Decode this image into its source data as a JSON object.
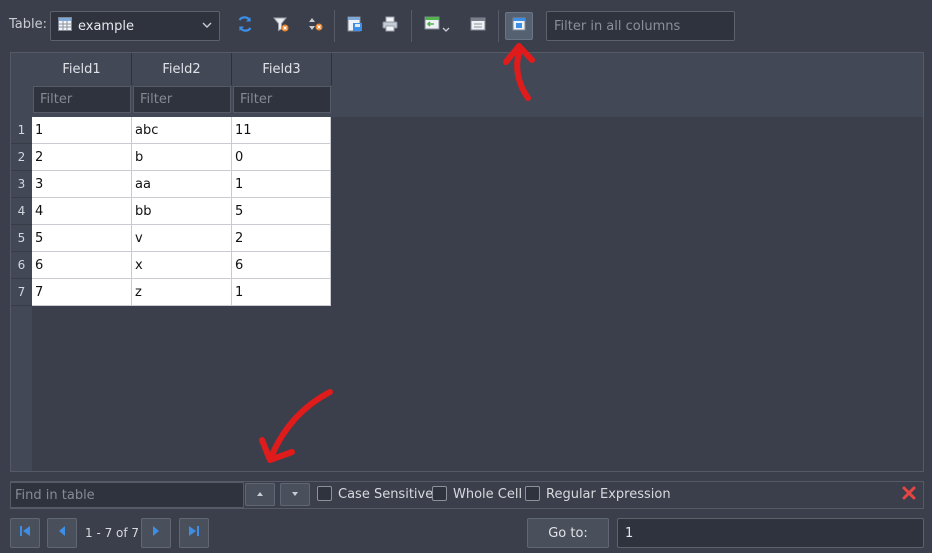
{
  "toolbar": {
    "table_label": "Table:",
    "table_value": "example",
    "filter_all_placeholder": "Filter in all columns"
  },
  "icons": {
    "table_icon": "table-icon",
    "refresh": "refresh-icon",
    "clear_filters": "clear-filter-icon",
    "clear_sort": "clear-sort-icon",
    "save_changes": "save-filter-view-icon",
    "print": "print-icon",
    "insert_record": "insert-record-icon",
    "delete_record": "delete-record-icon",
    "toggle_format": "toggle-format-toolbar-icon"
  },
  "grid": {
    "columns": [
      "Field1",
      "Field2",
      "Field3"
    ],
    "filter_placeholder": "Filter",
    "rows": [
      {
        "num": "1",
        "cells": [
          "1",
          "abc",
          "11"
        ]
      },
      {
        "num": "2",
        "cells": [
          "2",
          "b",
          "0"
        ]
      },
      {
        "num": "3",
        "cells": [
          "3",
          "aa",
          "1"
        ]
      },
      {
        "num": "4",
        "cells": [
          "4",
          "bb",
          "5"
        ]
      },
      {
        "num": "5",
        "cells": [
          "5",
          "v",
          "2"
        ]
      },
      {
        "num": "6",
        "cells": [
          "6",
          "x",
          "6"
        ]
      },
      {
        "num": "7",
        "cells": [
          "7",
          "z",
          "1"
        ]
      }
    ]
  },
  "find": {
    "placeholder": "Find in table",
    "case_sensitive": "Case Sensitive",
    "whole_cell": "Whole Cell",
    "regex": "Regular Expression"
  },
  "nav": {
    "record_count": "1 - 7 of 7",
    "goto_label": "Go to:",
    "goto_value": "1"
  },
  "colors": {
    "background": "#3b3f4b",
    "annotation_arrow": "#e01b1b",
    "accent_blue": "#3d8ee6"
  }
}
